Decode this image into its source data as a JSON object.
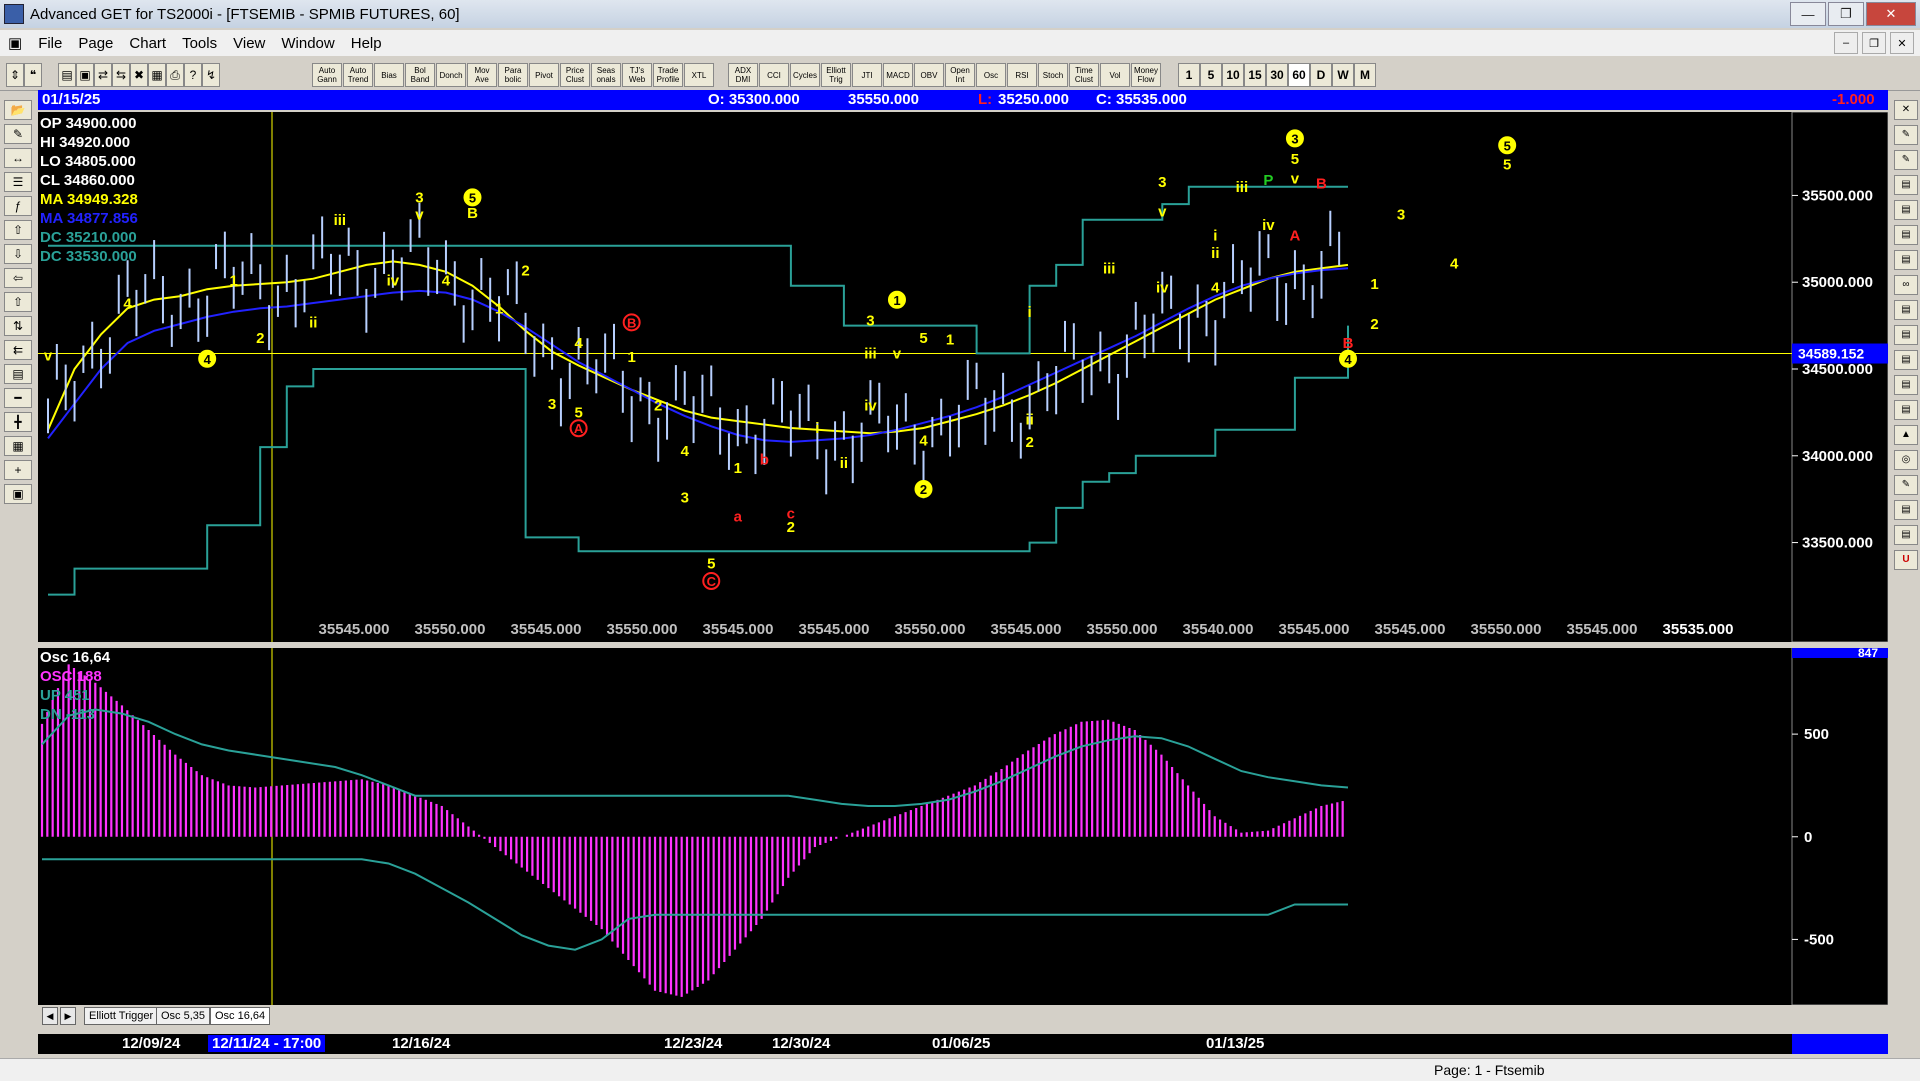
{
  "window": {
    "title": "Advanced GET for TS2000i - [FTSEMIB - SPMIB FUTURES, 60]"
  },
  "menu": [
    "File",
    "Page",
    "Chart",
    "Tools",
    "View",
    "Window",
    "Help"
  ],
  "toolbar": {
    "studies": [
      "Auto Gann",
      "Auto Trend",
      "Bias",
      "Bol Band",
      "Donch",
      "Mov Ave",
      "Para bolic",
      "Pivot",
      "Price Clust",
      "Seas onals",
      "TJ's Web",
      "Trade Profile",
      "XTL",
      "ADX DMI",
      "CCI",
      "Cycles",
      "Elliott Trig",
      "JTI",
      "MACD",
      "OBV",
      "Open Int",
      "Osc",
      "RSI",
      "Stoch",
      "Time Clust",
      "Vol",
      "Money Flow"
    ],
    "periods": [
      "1",
      "5",
      "10",
      "15",
      "30",
      "60",
      "D",
      "W",
      "M"
    ]
  },
  "infobar": {
    "date": "01/15/25",
    "open": "O: 35300.000",
    "high": "35550.000",
    "low_label": "L:",
    "low": "35250.000",
    "close": "C: 35535.000",
    "change": "-1.000"
  },
  "price_legend": [
    {
      "text": "OP  34900.000",
      "color": "#ffffff"
    },
    {
      "text": "HI   34920.000",
      "color": "#ffffff"
    },
    {
      "text": "LO  34805.000",
      "color": "#ffffff"
    },
    {
      "text": "CL  34860.000",
      "color": "#ffffff"
    },
    {
      "text": "MA  34949.328",
      "color": "#ffff00"
    },
    {
      "text": "MA  34877.856",
      "color": "#2222ff"
    },
    {
      "text": "DC  35210.000",
      "color": "#2aa198"
    },
    {
      "text": "DC  33530.000",
      "color": "#2aa198"
    }
  ],
  "price_axis": {
    "ticks": [
      35500,
      35000,
      34500,
      34000,
      33500
    ],
    "ticks_text": [
      "35500.000",
      "35000.000",
      "34500.000",
      "34000.000",
      "33500.000"
    ],
    "current": "34589.152",
    "current_value": 34589.152,
    "range": [
      33100,
      35900
    ]
  },
  "bottom_readouts": [
    "35545.000",
    "35550.000",
    "35545.000",
    "35550.000",
    "35545.000",
    "35545.000",
    "35550.000",
    "35545.000",
    "35550.000",
    "35540.000",
    "35545.000",
    "35545.000",
    "35550.000",
    "35545.000",
    "35535.000"
  ],
  "osc_legend": [
    {
      "text": "Osc 16,64",
      "color": "#ffffff"
    },
    {
      "text": "OSC 188",
      "color": "#ff33ff"
    },
    {
      "text": "UP   451",
      "color": "#2aa198"
    },
    {
      "text": "DN   -113",
      "color": "#2aa198"
    }
  ],
  "osc_axis": {
    "ticks": [
      500,
      0,
      -500
    ],
    "ticks_text": [
      "500",
      "0",
      "-500"
    ],
    "top_value": "847",
    "range": [
      -800,
      900
    ]
  },
  "tabs": [
    "Elliott Trigger",
    "Osc 5,35",
    "Osc 16,64"
  ],
  "dates": [
    {
      "label": "12/09/24",
      "highlight": false
    },
    {
      "label": "12/11/24 - 17:00",
      "highlight": true
    },
    {
      "label": "12/16/24",
      "highlight": false
    },
    {
      "label": "12/23/24",
      "highlight": false
    },
    {
      "label": "12/30/24",
      "highlight": false
    },
    {
      "label": "01/06/25",
      "highlight": false
    },
    {
      "label": "01/13/25",
      "highlight": false
    }
  ],
  "status": "Page: 1 - Ftsemib",
  "colors": {
    "ma_fast": "#ffff00",
    "ma_slow": "#2222ff",
    "donchian": "#2aa198",
    "osc": "#ff33ff",
    "wave_yellow": "#ffff00",
    "wave_red": "#ff2020",
    "wave_green": "#22cc22"
  },
  "chart_data": {
    "type": "candlestick",
    "y_range": [
      33100,
      35900
    ],
    "series": [
      {
        "name": "MA",
        "values": [
          34150,
          34500,
          34700,
          34850,
          34900,
          34920,
          34960,
          34980,
          34990,
          35000,
          35020,
          35060,
          35100,
          35120,
          35100,
          35060,
          34980,
          34860,
          34720,
          34600,
          34520,
          34450,
          34380,
          34320,
          34260,
          34220,
          34200,
          34180,
          34160,
          34150,
          34140,
          34130,
          34140,
          34160,
          34200,
          34240,
          34290,
          34350,
          34420,
          34500,
          34580,
          34660,
          34740,
          34820,
          34900,
          34960,
          35020,
          35060,
          35080,
          35100
        ]
      },
      {
        "name": "MA",
        "values": [
          34100,
          34300,
          34500,
          34650,
          34720,
          34760,
          34800,
          34830,
          34850,
          34860,
          34880,
          34900,
          34920,
          34940,
          34950,
          34940,
          34900,
          34830,
          34740,
          34640,
          34540,
          34460,
          34380,
          34300,
          34230,
          34170,
          34120,
          34090,
          34080,
          34090,
          34100,
          34120,
          34150,
          34190,
          34230,
          34280,
          34340,
          34410,
          34480,
          34550,
          34620,
          34690,
          34770,
          34850,
          34920,
          34980,
          35020,
          35050,
          35070,
          35080
        ]
      },
      {
        "name": "DC",
        "values": [
          35210,
          35210,
          35210,
          35210,
          35210,
          35210,
          35210,
          35210,
          35210,
          35210,
          35210,
          35210,
          35210,
          35210,
          35210,
          35210,
          35210,
          35210,
          35210,
          35210,
          35210,
          35210,
          35210,
          35210,
          35210,
          35210,
          35210,
          35210,
          34980,
          34980,
          34750,
          34750,
          34750,
          34750,
          34750,
          34590,
          34590,
          34980,
          35100,
          35360,
          35360,
          35360,
          35450,
          35550,
          35550,
          35550,
          35550,
          35550,
          35550,
          35550
        ]
      },
      {
        "name": "DC",
        "values": [
          33200,
          33350,
          33350,
          33350,
          33350,
          33350,
          33600,
          33600,
          34050,
          34400,
          34500,
          34500,
          34500,
          34500,
          34500,
          34500,
          34500,
          34500,
          33530,
          33530,
          33450,
          33450,
          33450,
          33450,
          33450,
          33450,
          33450,
          33450,
          33450,
          33450,
          33450,
          33450,
          33450,
          33450,
          33450,
          33450,
          33450,
          33500,
          33700,
          33850,
          33900,
          34000,
          34000,
          34000,
          34150,
          34150,
          34150,
          34450,
          34450,
          34750
        ]
      }
    ],
    "osc": {
      "name": "OSC",
      "values": [
        550,
        840,
        750,
        640,
        520,
        400,
        300,
        250,
        240,
        250,
        260,
        270,
        280,
        250,
        200,
        150,
        50,
        -50,
        -150,
        -250,
        -350,
        -450,
        -600,
        -750,
        -780,
        -700,
        -550,
        -400,
        -200,
        -50,
        0,
        50,
        100,
        150,
        200,
        250,
        330,
        420,
        500,
        560,
        570,
        520,
        400,
        250,
        100,
        20,
        30,
        90,
        150,
        180
      ],
      "up": [
        450,
        590,
        620,
        600,
        560,
        500,
        450,
        420,
        400,
        380,
        360,
        340,
        300,
        250,
        200,
        200,
        200,
        200,
        200,
        200,
        200,
        200,
        200,
        200,
        200,
        200,
        200,
        200,
        200,
        180,
        160,
        150,
        150,
        160,
        180,
        220,
        270,
        330,
        390,
        440,
        470,
        490,
        480,
        440,
        380,
        320,
        290,
        270,
        250,
        240
      ],
      "dn": [
        -110,
        -110,
        -110,
        -110,
        -110,
        -110,
        -110,
        -110,
        -110,
        -110,
        -110,
        -110,
        -110,
        -130,
        -180,
        -250,
        -320,
        -400,
        -480,
        -530,
        -550,
        -500,
        -400,
        -380,
        -380,
        -380,
        -380,
        -380,
        -380,
        -380,
        -380,
        -380,
        -380,
        -380,
        -380,
        -380,
        -380,
        -380,
        -380,
        -380,
        -380,
        -380,
        -380,
        -380,
        -380,
        -380,
        -380,
        -330,
        -330,
        -330
      ]
    },
    "wave_labels": [
      {
        "text": "v",
        "i": 0,
        "y": 34550,
        "color": "yellow"
      },
      {
        "text": "4",
        "i": 3,
        "y": 34850,
        "color": "yellow"
      },
      {
        "text": "4",
        "i": 6,
        "y": 34530,
        "color": "yellow",
        "circle": true
      },
      {
        "text": "1",
        "i": 7,
        "y": 34980,
        "color": "yellow"
      },
      {
        "text": "2",
        "i": 8,
        "y": 34650,
        "color": "yellow"
      },
      {
        "text": "ii",
        "i": 10,
        "y": 34740,
        "color": "yellow"
      },
      {
        "text": "iii",
        "i": 11,
        "y": 35330,
        "color": "yellow"
      },
      {
        "text": "iv",
        "i": 13,
        "y": 34980,
        "color": "yellow"
      },
      {
        "text": "3",
        "i": 14,
        "y": 35460,
        "color": "yellow"
      },
      {
        "text": "v",
        "i": 14,
        "y": 35360,
        "color": "yellow"
      },
      {
        "text": "5",
        "i": 16,
        "y": 35460,
        "color": "yellow",
        "circle": true
      },
      {
        "text": "B",
        "i": 16,
        "y": 35370,
        "color": "yellow"
      },
      {
        "text": "4",
        "i": 15,
        "y": 34980,
        "color": "yellow"
      },
      {
        "text": "2",
        "i": 18,
        "y": 35040,
        "color": "yellow"
      },
      {
        "text": "1",
        "i": 17,
        "y": 34820,
        "color": "yellow"
      },
      {
        "text": "4",
        "i": 20,
        "y": 34620,
        "color": "yellow"
      },
      {
        "text": "3",
        "i": 19,
        "y": 34270,
        "color": "yellow"
      },
      {
        "text": "5",
        "i": 20,
        "y": 34220,
        "color": "yellow"
      },
      {
        "text": "A",
        "i": 20,
        "y": 34130,
        "color": "red",
        "circle": true
      },
      {
        "text": "B",
        "i": 22,
        "y": 34740,
        "color": "red",
        "circle": true
      },
      {
        "text": "1",
        "i": 22,
        "y": 34540,
        "color": "yellow"
      },
      {
        "text": "2",
        "i": 23,
        "y": 34260,
        "color": "yellow"
      },
      {
        "text": "4",
        "i": 24,
        "y": 34000,
        "color": "yellow"
      },
      {
        "text": "3",
        "i": 24,
        "y": 33730,
        "color": "yellow"
      },
      {
        "text": "5",
        "i": 25,
        "y": 33350,
        "color": "yellow"
      },
      {
        "text": "C",
        "i": 25,
        "y": 33250,
        "color": "red",
        "circle": true
      },
      {
        "text": "a",
        "i": 26,
        "y": 33620,
        "color": "red"
      },
      {
        "text": "1",
        "i": 26,
        "y": 33900,
        "color": "yellow"
      },
      {
        "text": "b",
        "i": 27,
        "y": 33950,
        "color": "red"
      },
      {
        "text": "c",
        "i": 28,
        "y": 33640,
        "color": "red"
      },
      {
        "text": "2",
        "i": 28,
        "y": 33560,
        "color": "yellow"
      },
      {
        "text": "i",
        "i": 29,
        "y": 34130,
        "color": "yellow"
      },
      {
        "text": "ii",
        "i": 30,
        "y": 33930,
        "color": "yellow"
      },
      {
        "text": "iii",
        "i": 31,
        "y": 34560,
        "color": "yellow"
      },
      {
        "text": "v",
        "i": 32,
        "y": 34560,
        "color": "yellow"
      },
      {
        "text": "iv",
        "i": 31,
        "y": 34260,
        "color": "yellow"
      },
      {
        "text": "3",
        "i": 31,
        "y": 34750,
        "color": "yellow"
      },
      {
        "text": "1",
        "i": 32,
        "y": 34870,
        "color": "yellow",
        "circle": true
      },
      {
        "text": "5",
        "i": 33,
        "y": 34650,
        "color": "yellow"
      },
      {
        "text": "4",
        "i": 33,
        "y": 34060,
        "color": "yellow"
      },
      {
        "text": "2",
        "i": 33,
        "y": 33780,
        "color": "yellow",
        "circle": true
      },
      {
        "text": "1",
        "i": 34,
        "y": 34640,
        "color": "yellow"
      },
      {
        "text": "2",
        "i": 37,
        "y": 34050,
        "color": "yellow"
      },
      {
        "text": "ii",
        "i": 37,
        "y": 34180,
        "color": "yellow"
      },
      {
        "text": "i",
        "i": 37,
        "y": 34800,
        "color": "yellow"
      },
      {
        "text": "iii",
        "i": 40,
        "y": 35050,
        "color": "yellow"
      },
      {
        "text": "3",
        "i": 42,
        "y": 35550,
        "color": "yellow"
      },
      {
        "text": "v",
        "i": 42,
        "y": 35380,
        "color": "yellow"
      },
      {
        "text": "iv",
        "i": 42,
        "y": 34940,
        "color": "yellow"
      },
      {
        "text": "4",
        "i": 44,
        "y": 34940,
        "color": "yellow"
      },
      {
        "text": "i",
        "i": 44,
        "y": 35240,
        "color": "yellow"
      },
      {
        "text": "ii",
        "i": 44,
        "y": 35140,
        "color": "yellow"
      },
      {
        "text": "iii",
        "i": 45,
        "y": 35520,
        "color": "yellow"
      },
      {
        "text": "P",
        "i": 46,
        "y": 35560,
        "color": "green"
      },
      {
        "text": "iv",
        "i": 46,
        "y": 35300,
        "color": "yellow"
      },
      {
        "text": "3",
        "i": 47,
        "y": 35800,
        "color": "yellow",
        "circle": true
      },
      {
        "text": "5",
        "i": 47,
        "y": 35680,
        "color": "yellow"
      },
      {
        "text": "v",
        "i": 47,
        "y": 35570,
        "color": "yellow"
      },
      {
        "text": "B",
        "i": 48,
        "y": 35540,
        "color": "red"
      },
      {
        "text": "A",
        "i": 47,
        "y": 35240,
        "color": "red"
      },
      {
        "text": "1",
        "i": 50,
        "y": 34960,
        "color": "yellow"
      },
      {
        "text": "2",
        "i": 50,
        "y": 34730,
        "color": "yellow"
      },
      {
        "text": "B",
        "i": 49,
        "y": 34620,
        "color": "red"
      },
      {
        "text": "4",
        "i": 49,
        "y": 34530,
        "color": "yellow",
        "circle": true
      },
      {
        "text": "3",
        "i": 51,
        "y": 35360,
        "color": "yellow"
      },
      {
        "text": "4",
        "i": 53,
        "y": 35080,
        "color": "yellow"
      },
      {
        "text": "5",
        "i": 55,
        "y": 35760,
        "color": "yellow",
        "circle": true
      },
      {
        "text": "5",
        "i": 55,
        "y": 35650,
        "color": "yellow"
      }
    ]
  }
}
